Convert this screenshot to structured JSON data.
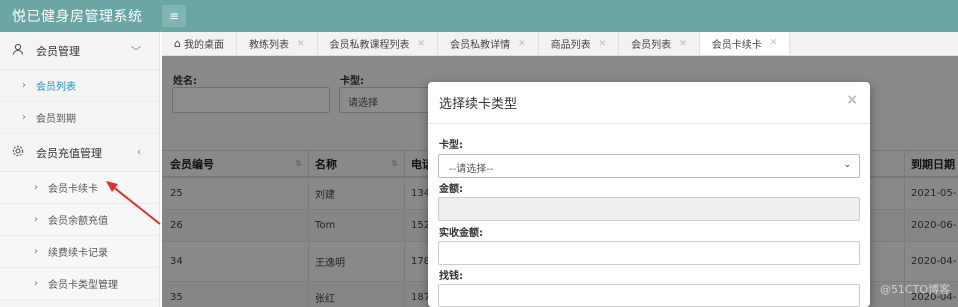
{
  "app": {
    "title": "悦已健身房管理系统"
  },
  "sidebar": {
    "groups": [
      {
        "label": "会员管理",
        "icon": "user-icon"
      },
      {
        "label": "会员充值管理",
        "icon": "settings-icon"
      }
    ],
    "member_items": [
      {
        "label": "会员列表"
      },
      {
        "label": "会员到期"
      }
    ],
    "recharge_items": [
      {
        "label": "会员卡续卡"
      },
      {
        "label": "会员余额充值"
      },
      {
        "label": "续费续卡记录"
      },
      {
        "label": "会员卡类型管理"
      }
    ]
  },
  "tabs": [
    {
      "label": "我的桌面",
      "icon": "home-icon"
    },
    {
      "label": "教练列表"
    },
    {
      "label": "会员私教课程列表"
    },
    {
      "label": "会员私教详情"
    },
    {
      "label": "商品列表"
    },
    {
      "label": "会员列表"
    },
    {
      "label": "会员卡续卡"
    }
  ],
  "filter": {
    "name_label": "姓名:",
    "card_label": "卡型:",
    "card_placeholder": "请选择"
  },
  "table": {
    "headers": [
      "会员编号",
      "名称",
      "电话",
      "到期日期"
    ],
    "rows": [
      {
        "id": "25",
        "name": "刘建",
        "phone": "134",
        "expire": "2021-05-"
      },
      {
        "id": "26",
        "name": "Tom",
        "phone": "152",
        "expire": "2020-06-"
      },
      {
        "id": "34",
        "name": "王逸明",
        "phone": "178",
        "expire": "2020-04-"
      },
      {
        "id": "35",
        "name": "张红",
        "phone": "187",
        "expire": "2020-04-"
      }
    ]
  },
  "modal": {
    "title": "选择续卡类型",
    "close": "×",
    "card_type_label": "卡型:",
    "card_type_value": "--请选择--",
    "amount_label": "金额:",
    "paid_label": "实收金额:",
    "change_label": "找钱:"
  },
  "watermark": "@51CTO博客"
}
